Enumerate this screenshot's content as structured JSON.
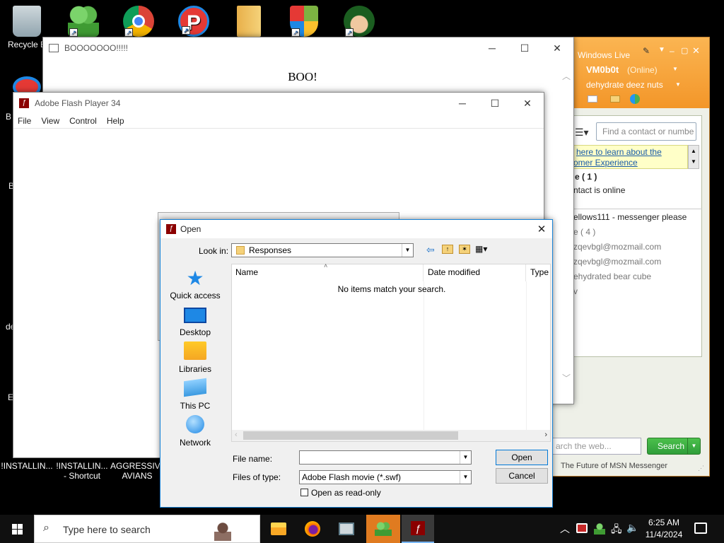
{
  "desktop": {
    "icons": [
      {
        "label": "Recycle B"
      },
      {
        "label": ""
      },
      {
        "label": ""
      },
      {
        "label": ""
      },
      {
        "label": ""
      },
      {
        "label": ""
      },
      {
        "label": ""
      }
    ],
    "bottom_icons": [
      {
        "label": "!INSTALLIN..."
      },
      {
        "label": "!INSTALLIN... - Shortcut"
      },
      {
        "label": "AGGRESSIVE AVIANS"
      }
    ],
    "left_partial_labels": [
      "B",
      "B",
      "de",
      "E"
    ]
  },
  "boo_window": {
    "title": "BOOOOOOO!!!!!",
    "content": "BOO!"
  },
  "flash_window": {
    "title": "Adobe Flash Player 34",
    "menu": [
      "File",
      "View",
      "Control",
      "Help"
    ]
  },
  "open_dialog": {
    "title": "Open",
    "look_in_label": "Look in:",
    "look_in_value": "Responses",
    "places": [
      "Quick access",
      "Desktop",
      "Libraries",
      "This PC",
      "Network"
    ],
    "columns": [
      "Name",
      "Date modified",
      "Type"
    ],
    "empty_message": "No items match your search.",
    "file_name_label": "File name:",
    "file_name_value": "",
    "files_of_type_label": "Files of type:",
    "files_of_type_value": "Adobe Flash movie (*.swf)",
    "read_only_label": "Open as read-only",
    "open_button": "Open",
    "cancel_button": "Cancel"
  },
  "msn": {
    "header_title": "Windows Live",
    "username": "VM0b0t",
    "status": "(Online)",
    "personal_message": "dehydrate deez nuts",
    "search_placeholder": "Find a contact or number",
    "banner_line1": "here to learn about the",
    "banner_line2": "omer Experience",
    "group_online": "e ( 1 )",
    "online_note": "ntact is online",
    "contacts": [
      "ellows111 - messenger please",
      "e ( 4 )",
      "zqevbgl@mozmail.com",
      "zqevbgl@mozmail.com",
      "ehydrated bear cube",
      "v"
    ],
    "web_search_placeholder": "arch the web...",
    "search_button": "Search",
    "footer": "The Future of MSN Messenger"
  },
  "taskbar": {
    "search_placeholder": "Type here to search",
    "time": "6:25 AM",
    "date": "11/4/2024"
  },
  "colors": {
    "msn_orange": "#f7a23c",
    "search_green": "#2f9e3a",
    "flash_red": "#8b0000",
    "accent_blue": "#0078d7"
  }
}
